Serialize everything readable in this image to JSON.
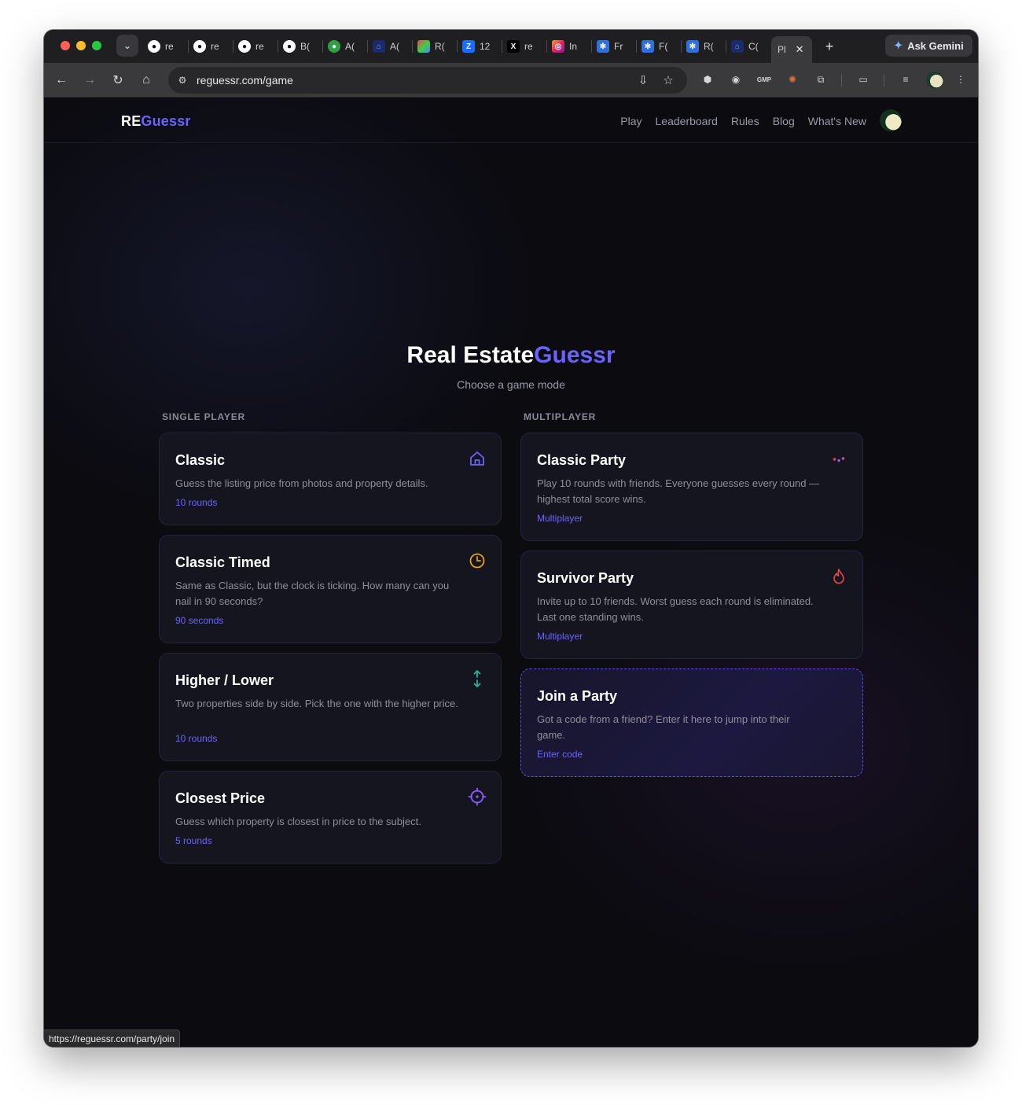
{
  "browser": {
    "tabs": [
      {
        "icon": "github-icon",
        "label": "re"
      },
      {
        "icon": "github-icon",
        "label": "re"
      },
      {
        "icon": "github-icon",
        "label": "re"
      },
      {
        "icon": "github-icon",
        "label": "B("
      },
      {
        "icon": "github-copilot-icon",
        "label": "A("
      },
      {
        "icon": "home-icon",
        "label": "A("
      },
      {
        "icon": "colorful-app-icon",
        "label": "R("
      },
      {
        "icon": "zillow-icon",
        "label": "12"
      },
      {
        "icon": "x-icon",
        "label": "re"
      },
      {
        "icon": "instagram-icon",
        "label": "In"
      },
      {
        "icon": "gear-app-icon",
        "label": "Fr"
      },
      {
        "icon": "gear-app-icon",
        "label": "F("
      },
      {
        "icon": "gear-app-icon",
        "label": "R("
      },
      {
        "icon": "home-icon",
        "label": "C("
      },
      {
        "icon": "",
        "label": "Pl",
        "active": true
      }
    ],
    "gemini_label": "Ask Gemini",
    "url": "reguessr.com/game",
    "status_url": "https://reguessr.com/party/join"
  },
  "nav": {
    "logo_prefix": "RE",
    "logo_suffix": "Guessr",
    "links": [
      "Play",
      "Leaderboard",
      "Rules",
      "Blog",
      "What's New"
    ]
  },
  "hero": {
    "title_prefix": "Real Estate",
    "title_suffix": "Guessr",
    "subtitle": "Choose a game mode"
  },
  "sections": {
    "single": "SINGLE PLAYER",
    "multi": "MULTIPLAYER"
  },
  "single_player": [
    {
      "title": "Classic",
      "desc": "Guess the listing price from photos and property details.",
      "meta": "10 rounds",
      "icon": "house-icon"
    },
    {
      "title": "Classic Timed",
      "desc": "Same as Classic, but the clock is ticking. How many can you nail in 90 seconds?",
      "meta": "90 seconds",
      "icon": "clock-icon"
    },
    {
      "title": "Higher / Lower",
      "desc": "Two properties side by side. Pick the one with the higher price.",
      "meta": "10 rounds",
      "icon": "up-down-arrows-icon"
    },
    {
      "title": "Closest Price",
      "desc": "Guess which property is closest in price to the subject.",
      "meta": "5 rounds",
      "icon": "crosshair-icon"
    }
  ],
  "multiplayer": [
    {
      "title": "Classic Party",
      "desc": "Play 10 rounds with friends. Everyone guesses every round — highest total score wins.",
      "meta": "Multiplayer",
      "icon": "party-dots-icon"
    },
    {
      "title": "Survivor Party",
      "desc": "Invite up to 10 friends. Worst guess each round is eliminated. Last one standing wins.",
      "meta": "Multiplayer",
      "icon": "flame-icon"
    },
    {
      "title": "Join a Party",
      "desc": "Got a code from a friend? Enter it here to jump into their game.",
      "meta": "Enter code",
      "icon": ""
    }
  ],
  "colors": {
    "accent": "#6b63ff",
    "background": "#0b0b10",
    "card": "#15151f",
    "clock": "#e0a020",
    "arrows": "#1fb59a",
    "crosshair": "#8a5cff",
    "flame": "#e0444a"
  }
}
